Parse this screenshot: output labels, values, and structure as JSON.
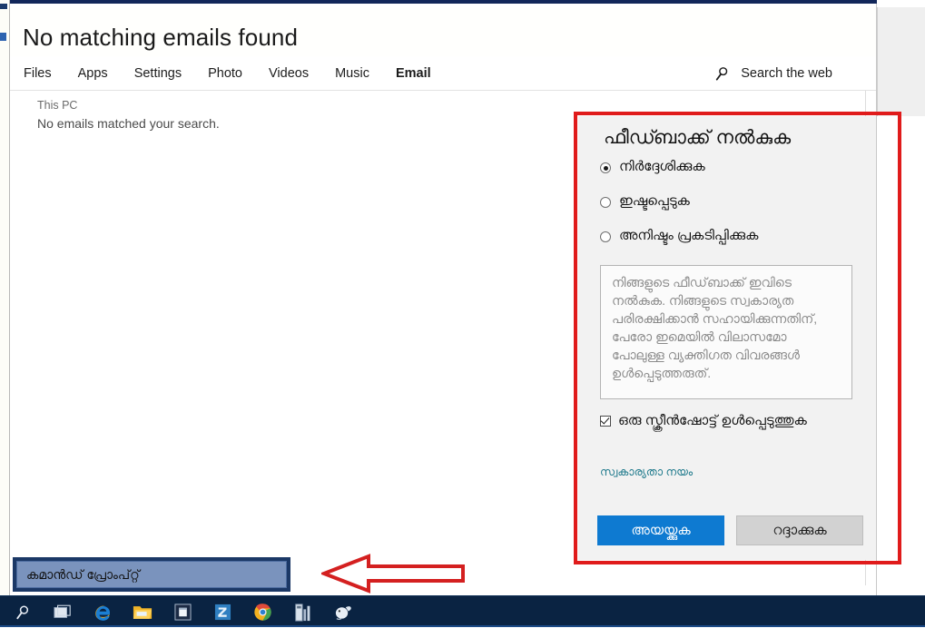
{
  "window": {
    "title": "No matching emails found",
    "tabs": [
      {
        "label": "Files",
        "active": false
      },
      {
        "label": "Apps",
        "active": false
      },
      {
        "label": "Settings",
        "active": false
      },
      {
        "label": "Photo",
        "active": false
      },
      {
        "label": "Videos",
        "active": false
      },
      {
        "label": "Music",
        "active": false
      },
      {
        "label": "Email",
        "active": true
      }
    ],
    "search_web_label": "Search the web",
    "search_icon": "search-icon"
  },
  "results": {
    "group_label": "This PC",
    "empty_message": "No emails matched your search."
  },
  "feedback": {
    "title": "ഫീഡ്ബാക്ക് നൽകുക",
    "options": [
      {
        "label": "നിർദ്ദേശിക്കുക",
        "selected": true
      },
      {
        "label": "ഇഷ്ടപ്പെടുക",
        "selected": false
      },
      {
        "label": "അനിഷ്ടം പ്രകടിപ്പിക്കുക",
        "selected": false
      }
    ],
    "comment_value": "",
    "comment_placeholder": "നിങ്ങളുടെ ഫീഡ്‌ബാക്ക് ഇവിടെ നൽകുക. നിങ്ങളുടെ സ്വകാര്യത പരിരക്ഷിക്കാൻ സഹായിക്കുന്നതിന്, പേരോ ഇമെയിൽ വിലാസമോ പോലുള്ള വ്യക്തിഗത വിവരങ്ങൾ ഉൾപ്പെടുത്തരുത്.",
    "screenshot_checkbox": {
      "label": "ഒരു സ്ക്രീൻഷോട്ട് ഉൾപ്പെടുത്തുക",
      "checked": true
    },
    "privacy_link": "സ്വകാര്യതാ നയം",
    "send_label": "അയയ്ക്കുക",
    "cancel_label": "റദ്ദാക്കുക",
    "highlight_color": "#e01b1b",
    "send_color": "#0e7ad1",
    "link_color": "#1f7a8c"
  },
  "taskbar": {
    "search_value": "കമാൻഡ് പ്രോംപ്റ്റ്",
    "background_color": "#0a2342",
    "icons": [
      {
        "name": "search-icon"
      },
      {
        "name": "task-view-icon"
      },
      {
        "name": "internet-explorer-icon"
      },
      {
        "name": "file-explorer-icon"
      },
      {
        "name": "microsoft-store-icon"
      },
      {
        "name": "skype-icon"
      },
      {
        "name": "chrome-icon"
      },
      {
        "name": "calculator-icon"
      },
      {
        "name": "media-player-icon"
      }
    ]
  },
  "annotation": {
    "arrow_direction": "left",
    "arrow_color": "#d42020"
  }
}
